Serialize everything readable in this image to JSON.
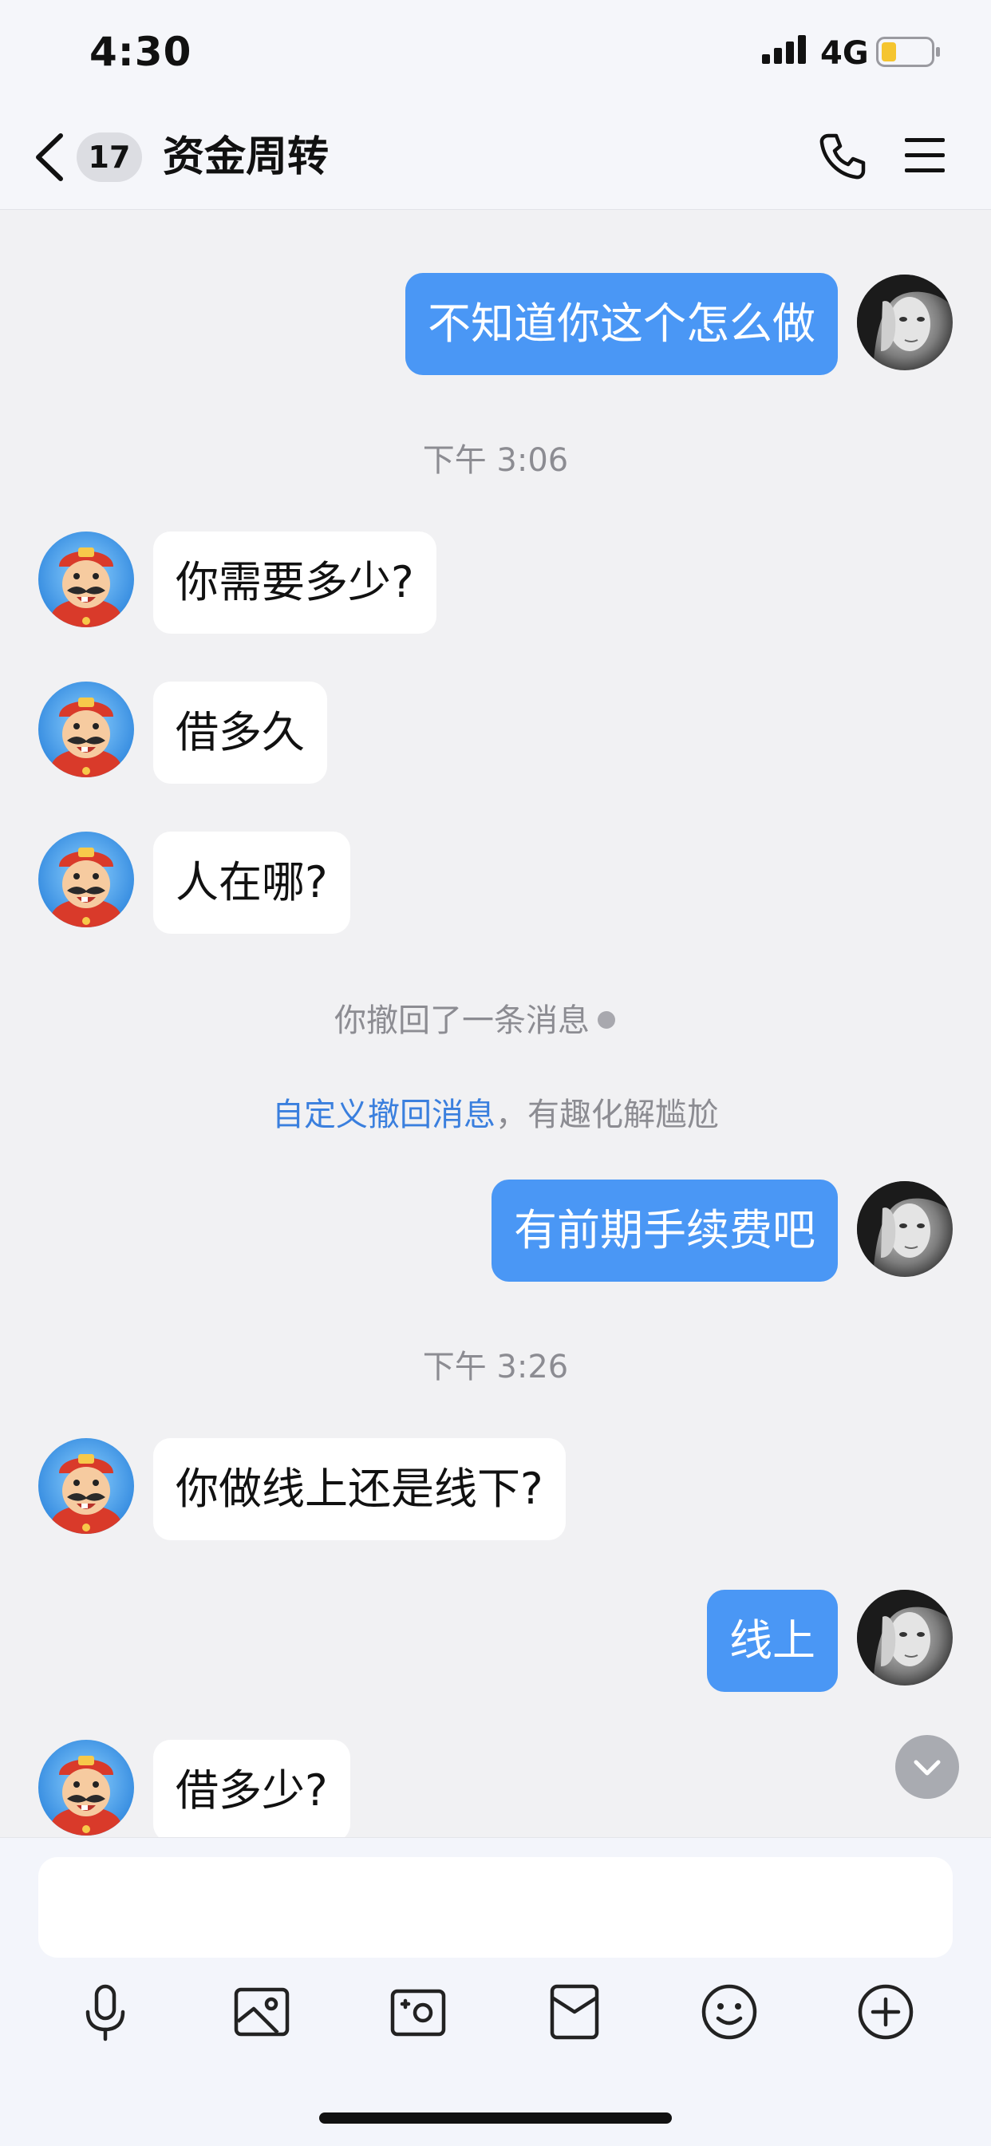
{
  "status_bar": {
    "time": "4:30",
    "network": "4G",
    "battery_color": "#f5c52f"
  },
  "header": {
    "unread_count": "17",
    "title": "资金周转"
  },
  "chat": {
    "messages": [
      {
        "side": "out",
        "text": "不知道你这个怎么做"
      },
      {
        "side": "in",
        "text": "你需要多少?"
      },
      {
        "side": "in",
        "text": "借多久"
      },
      {
        "side": "in",
        "text": "人在哪?"
      },
      {
        "side": "out",
        "text": "有前期手续费吧"
      },
      {
        "side": "in",
        "text": "你做线上还是线下?"
      },
      {
        "side": "out",
        "text": "线上"
      },
      {
        "side": "in",
        "text": "借多少?"
      }
    ],
    "timestamps": [
      "下午 3:06",
      "下午 3:26"
    ],
    "recall_notice": "你撤回了一条消息",
    "recall_hint_link": "自定义撤回消息",
    "recall_hint_rest": "，有趣化解尴尬"
  },
  "colors": {
    "outgoing_bubble": "#4a97f5",
    "incoming_bubble": "#ffffff",
    "link": "#3a7fde"
  },
  "toolbar": {
    "icons": [
      "microphone-icon",
      "image-icon",
      "camera-icon",
      "red-packet-icon",
      "emoji-icon",
      "plus-icon"
    ]
  }
}
